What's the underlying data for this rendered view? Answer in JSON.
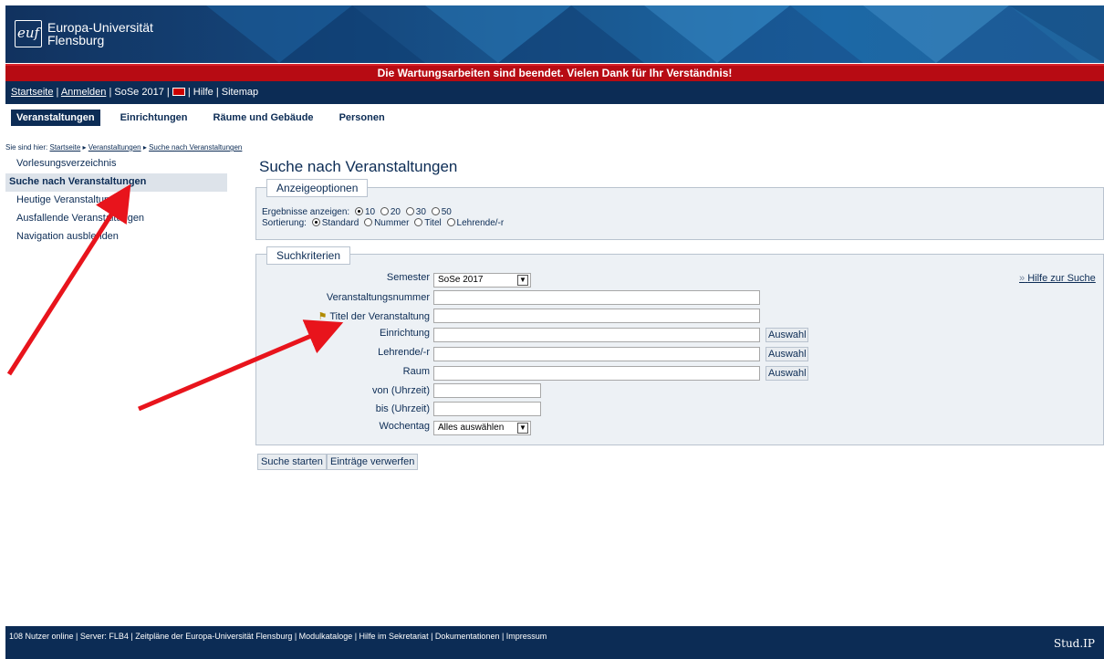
{
  "header": {
    "logo_mark": "euf",
    "university_name_line1": "Europa-Universität",
    "university_name_line2": "Flensburg"
  },
  "maintenance_banner": "Die Wartungsarbeiten sind beendet. Vielen Dank für Ihr Verständnis!",
  "topnav": {
    "home": "Startseite",
    "login": "Anmelden",
    "semester": "SoSe 2017",
    "help": "Hilfe",
    "sitemap": "Sitemap"
  },
  "tabs": [
    {
      "label": "Veranstaltungen",
      "active": true
    },
    {
      "label": "Einrichtungen",
      "active": false
    },
    {
      "label": "Räume und Gebäude",
      "active": false
    },
    {
      "label": "Personen",
      "active": false
    }
  ],
  "breadcrumb": {
    "prefix": "Sie sind hier:",
    "items": [
      "Startseite",
      "Veranstaltungen",
      "Suche nach Veranstaltungen"
    ]
  },
  "sidebar": {
    "items": [
      {
        "label": "Vorlesungsverzeichnis",
        "active": false
      },
      {
        "label": "Suche nach Veranstaltungen",
        "active": true
      },
      {
        "label": "Heutige Veranstaltungen",
        "active": false
      },
      {
        "label": "Ausfallende Veranstaltungen",
        "active": false
      },
      {
        "label": "Navigation ausblenden",
        "active": false
      }
    ]
  },
  "main": {
    "title": "Suche nach Veranstaltungen",
    "display_options": {
      "legend": "Anzeigeoptionen",
      "results_label": "Ergebnisse anzeigen:",
      "results_options": [
        "10",
        "20",
        "30",
        "50"
      ],
      "results_selected": "10",
      "sort_label": "Sortierung:",
      "sort_options": [
        "Standard",
        "Nummer",
        "Titel",
        "Lehrende/-r"
      ],
      "sort_selected": "Standard"
    },
    "criteria": {
      "legend": "Suchkriterien",
      "help_link": "Hilfe zur Suche",
      "semester_label": "Semester",
      "semester_value": "SoSe 2017",
      "number_label": "Veranstaltungsnummer",
      "number_value": "",
      "title_label": "Titel der Veranstaltung",
      "title_value": "",
      "institution_label": "Einrichtung",
      "institution_value": "",
      "lecturer_label": "Lehrende/-r",
      "lecturer_value": "",
      "room_label": "Raum",
      "room_value": "",
      "from_label": "von (Uhrzeit)",
      "from_value": "",
      "to_label": "bis (Uhrzeit)",
      "to_value": "",
      "weekday_label": "Wochentag",
      "weekday_value": "Alles auswählen",
      "select_button": "Auswahl"
    },
    "start_search": "Suche starten",
    "discard": "Einträge verwerfen"
  },
  "footer": {
    "text": "108 Nutzer online | Server: FLB4 | Zeitpläne der Europa-Universität Flensburg | Modulkataloge | Hilfe im Sekretariat | Dokumentationen | Impressum",
    "brand": "Stud.IP"
  },
  "colors": {
    "navy": "#0c2c55",
    "maintenance_red": "#b70b13",
    "panel_bg": "#edf1f5",
    "arrow_red": "#e8141c"
  }
}
